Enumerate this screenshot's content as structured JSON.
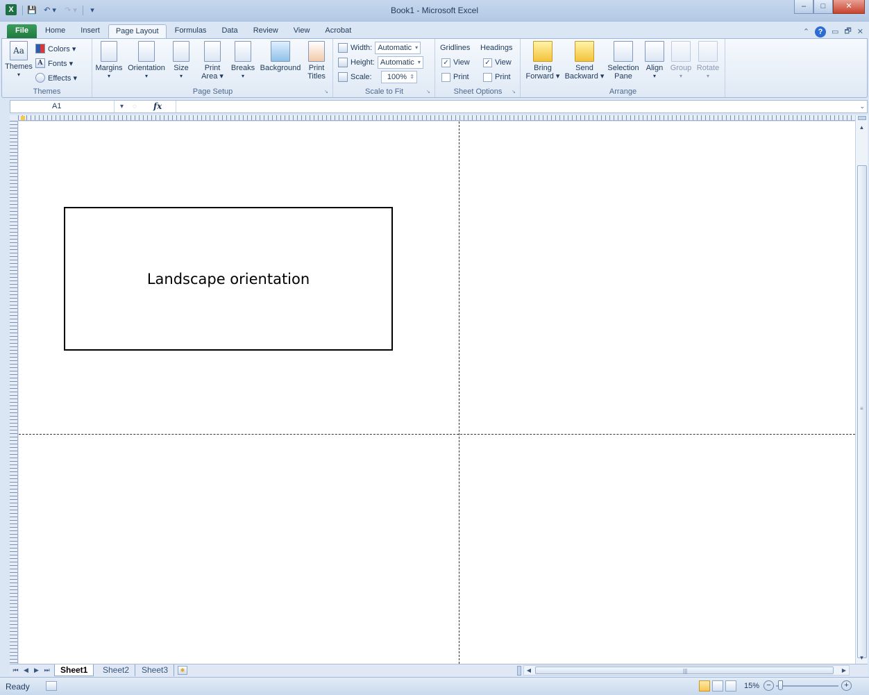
{
  "window": {
    "title": "Book1  -  Microsoft Excel",
    "app_icon": "X",
    "controls": {
      "minimize": "–",
      "maximize": "□",
      "close": "✕"
    }
  },
  "qat": {
    "save": "💾",
    "undo": "↶ ▾",
    "redo": "↷ ▾",
    "customize": "▾"
  },
  "tabs": [
    "File",
    "Home",
    "Insert",
    "Page Layout",
    "Formulas",
    "Data",
    "Review",
    "View",
    "Acrobat"
  ],
  "active_tab": "Page Layout",
  "tabs_right": {
    "minimize_ribbon": "⌃",
    "help": "?",
    "restore": "▭",
    "window": "🗗",
    "close": "✕"
  },
  "ribbon": {
    "themes": {
      "group_label": "Themes",
      "themes_label": "Themes",
      "themes_arrow": "▾",
      "themes_glyph": "Aa",
      "colors": "Colors ▾",
      "fonts": "Fonts ▾",
      "fonts_glyph": "A",
      "effects": "Effects ▾"
    },
    "page_setup": {
      "group_label": "Page Setup",
      "margins": "Margins",
      "orientation": "Orientation",
      "size": "Size",
      "print_area_1": "Print",
      "print_area_2": "Area ▾",
      "breaks": "Breaks",
      "background": "Background",
      "print_titles_1": "Print",
      "print_titles_2": "Titles",
      "dropdown_arrow": "▾"
    },
    "scale_to_fit": {
      "group_label": "Scale to Fit",
      "width_label": "Width:",
      "width_value": "Automatic",
      "height_label": "Height:",
      "height_value": "Automatic",
      "scale_label": "Scale:",
      "scale_value": "100%",
      "combo_arrow": "▾",
      "spin": "⇕"
    },
    "sheet_options": {
      "group_label": "Sheet Options",
      "gridlines": "Gridlines",
      "headings": "Headings",
      "view": "View",
      "print": "Print",
      "check_mark": "✓"
    },
    "arrange": {
      "group_label": "Arrange",
      "bring_forward_1": "Bring",
      "bring_forward_2": "Forward ▾",
      "send_backward_1": "Send",
      "send_backward_2": "Backward ▾",
      "selection_pane_1": "Selection",
      "selection_pane_2": "Pane",
      "align": "Align",
      "group": "Group",
      "rotate": "Rotate",
      "dropdown_arrow": "▾"
    },
    "launcher": "↘"
  },
  "formula_bar": {
    "name_box": "A1",
    "arrow": "▾",
    "cancel": "◌",
    "fx": "fx",
    "expand": "⌄",
    "formula": ""
  },
  "sheet": {
    "textbox": "Landscape orientation"
  },
  "vscroll": {
    "up": "▲",
    "down": "▼",
    "grip": "≡"
  },
  "sheet_tabs": {
    "nav": [
      "⏮",
      "◀",
      "▶",
      "⏭"
    ],
    "tabs": [
      "Sheet1",
      "Sheet2",
      "Sheet3"
    ],
    "active": "Sheet1",
    "new_sheet": "✱"
  },
  "hscroll": {
    "left": "◀",
    "right": "▶",
    "grip": "|||"
  },
  "status": {
    "ready": "Ready",
    "zoom": "15%",
    "zoom_out": "−",
    "zoom_in": "+"
  },
  "colors": {
    "accent": "#1d7044",
    "ribbon_border": "#9fb6d6",
    "frame": "#dbe6f4"
  }
}
